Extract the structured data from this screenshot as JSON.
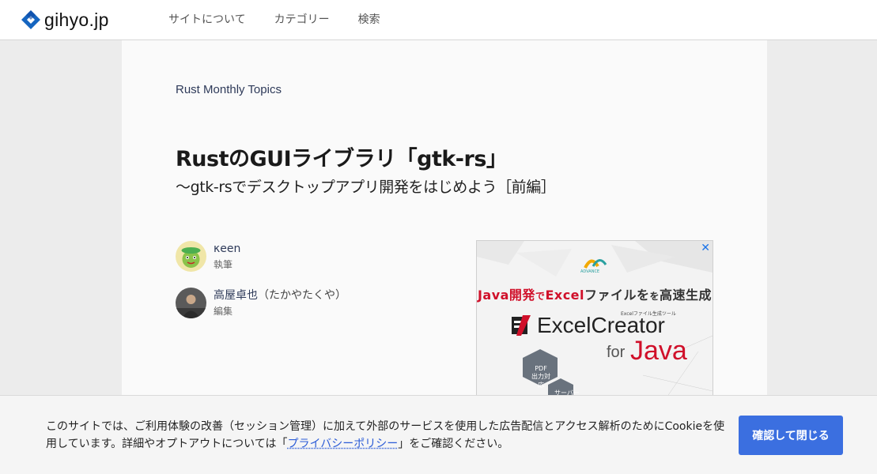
{
  "header": {
    "logo_text": "gihyo.jp",
    "nav": [
      {
        "label": "サイトについて"
      },
      {
        "label": "カテゴリー"
      },
      {
        "label": "検索"
      }
    ]
  },
  "article": {
    "series": "Rust Monthly Topics",
    "title": "RustのGUIライブラリ「gtk-rs」",
    "subtitle": "〜gtk-rsでデスクトップアプリ開発をはじめよう［前編］",
    "people": [
      {
        "name": "κeen",
        "kana": "",
        "role": "執筆"
      },
      {
        "name": "高屋卓也",
        "kana": "（たかやたくや）",
        "role": "編集"
      }
    ]
  },
  "ad": {
    "brand": "ADVANCE",
    "close_icon": "close-icon",
    "headline_1": "Java開発",
    "headline_2": "で",
    "headline_3": "Excel",
    "headline_4": "ファイルを",
    "headline_5": "高速生成",
    "product": "ExcelCreator",
    "product_sub": "Excelファイル生成ツール",
    "for": "for",
    "java": "Java",
    "hex1": [
      "PDF",
      "出力対応"
    ],
    "hex2": "サーバー"
  },
  "cookie": {
    "text_1": "このサイトでは、ご利用体験の改善（セッション管理）に加えて外部のサービスを使用した広告配信とアクセス解析のためにCookieを使用しています。詳細やオプトアウトについては「",
    "link": "プライバシーポリシー",
    "text_2": "」をご確認ください。",
    "button": "確認して閉じる"
  },
  "colors": {
    "accent": "#3b6fe0",
    "logo_blue": "#1565c0",
    "ad_red": "#d0102a"
  }
}
